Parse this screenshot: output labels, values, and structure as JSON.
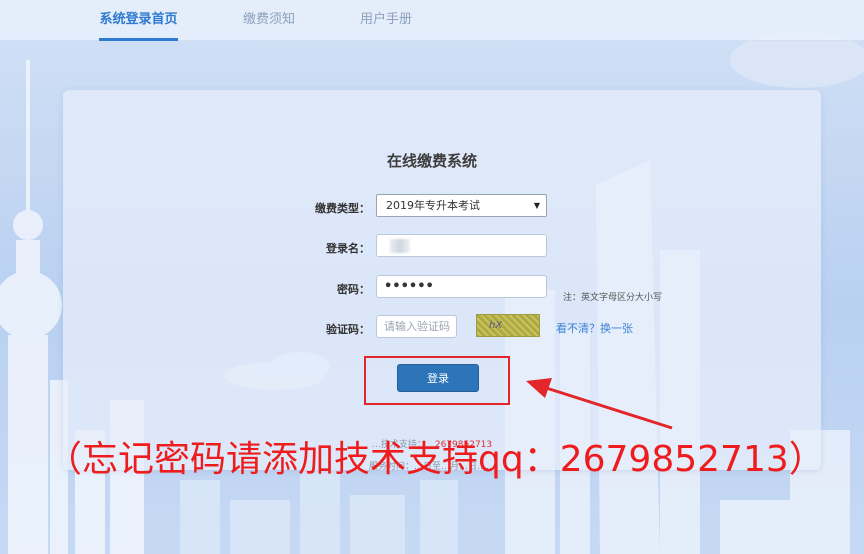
{
  "nav": {
    "tabs": [
      {
        "label": "系统登录首页"
      },
      {
        "label": "缴费须知"
      },
      {
        "label": "用户手册"
      }
    ]
  },
  "form": {
    "title": "在线缴费系统",
    "type_label": "缴费类型：",
    "type_value": "2019年专升本考试",
    "name_label": "登录名：",
    "password_label": "密码：",
    "password_value": "••••••",
    "case_note": "注：英文字母区分大小写",
    "captcha_label": "验证码：",
    "captcha_placeholder": "请输入验证码",
    "captcha_text": "hX",
    "refresh_label": "看不清？换一张",
    "login_label": "登录"
  },
  "footer": {
    "line1_pre": "…技术支持：…",
    "line1_phone": "2679852713",
    "line2": "服务时间：…日至…月…日……"
  },
  "overlay": {
    "text": "（忘记密码请添加技术支持qq：2679852713）"
  },
  "colors": {
    "accent": "#2f7ad1",
    "button": "#2d74b9",
    "annotation_red": "#ee1c1c"
  }
}
